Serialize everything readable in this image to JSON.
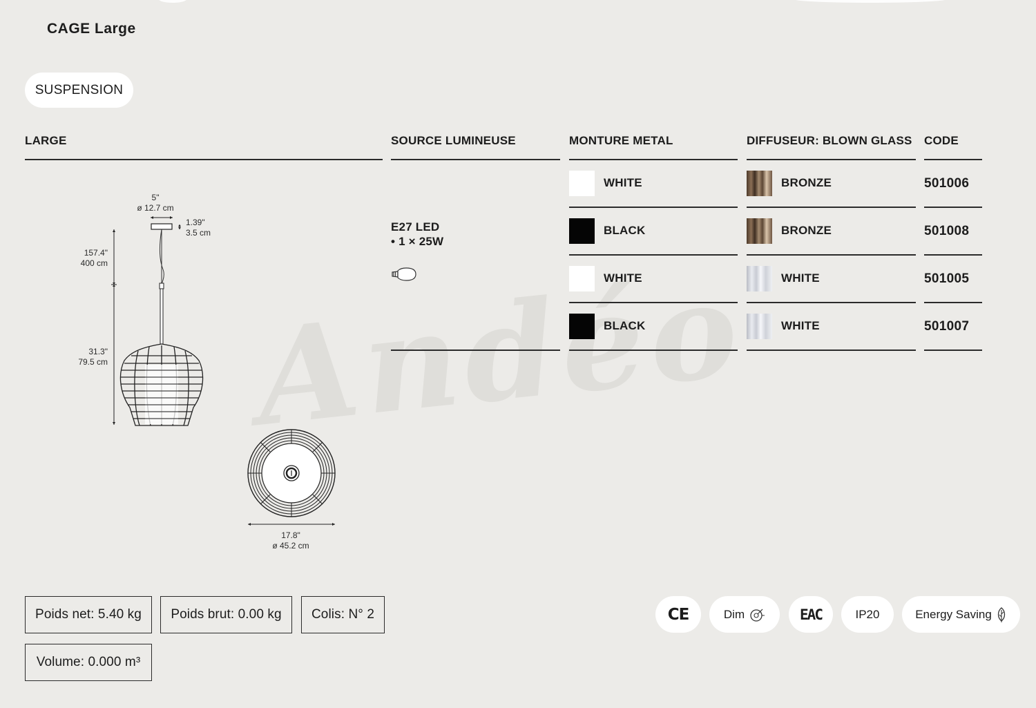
{
  "product": {
    "title": "CAGE Large",
    "category": "SUSPENSION"
  },
  "watermark": "Andéo",
  "table": {
    "headers": {
      "size": "LARGE",
      "source": "SOURCE LUMINEUSE",
      "frame": "MONTURE METAL",
      "diffuser": "DIFFUSEUR: BLOWN GLASS",
      "code": "CODE"
    },
    "source": {
      "line1": "E27 LED",
      "line2": "• 1 × 25W",
      "icon": "led-bulb-icon"
    },
    "rows": [
      {
        "frame": "WHITE",
        "frame_color": "#ffffff",
        "diffuser": "BRONZE",
        "code": "501006"
      },
      {
        "frame": "BLACK",
        "frame_color": "#050505",
        "diffuser": "BRONZE",
        "code": "501008"
      },
      {
        "frame": "WHITE",
        "frame_color": "#ffffff",
        "diffuser": "WHITE",
        "code": "501005"
      },
      {
        "frame": "BLACK",
        "frame_color": "#050505",
        "diffuser": "WHITE",
        "code": "501007"
      }
    ]
  },
  "dimensions": {
    "canopy_w_in": "5\"",
    "canopy_w_cm": "ø 12.7 cm",
    "canopy_h_in": "1.39\"",
    "canopy_h_cm": "3.5 cm",
    "cable_in": "157.4\"",
    "cable_cm": "400 cm",
    "height_in": "31.3\"",
    "height_cm": "79.5 cm",
    "diameter_in": "17.8\"",
    "diameter_cm": "ø 45.2 cm"
  },
  "packaging": {
    "net_weight": "Poids net: 5.40 kg",
    "gross_weight": "Poids brut: 0.00 kg",
    "packages": "Colis: N° 2",
    "volume": "Volume: 0.000 m³"
  },
  "certifications": {
    "ce": "CE",
    "dim": "Dim",
    "eac": "EAC",
    "ip": "IP20",
    "energy": "Energy Saving"
  }
}
